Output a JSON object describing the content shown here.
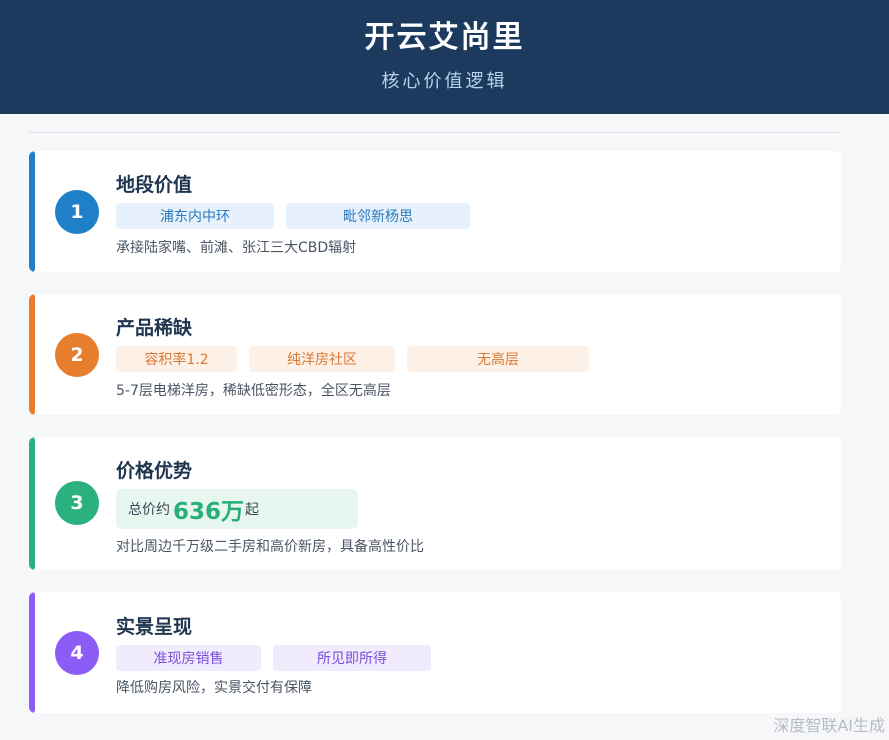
{
  "header": {
    "title": "开云艾尚里",
    "subtitle": "核心价值逻辑"
  },
  "cards": [
    {
      "number": "1",
      "title": "地段价值",
      "accent": "#1f80c8",
      "tags": [
        "浦东内中环",
        "毗邻新杨思"
      ],
      "description": "承接陆家嘴、前滩、张江三大CBD辐射"
    },
    {
      "number": "2",
      "title": "产品稀缺",
      "accent": "#e67e2e",
      "tags": [
        "容积率1.2",
        "纯洋房社区",
        "无高层"
      ],
      "description": "5-7层电梯洋房，稀缺低密形态，全区无高层"
    },
    {
      "number": "3",
      "title": "价格优势",
      "accent": "#2bb07f",
      "price": {
        "prefix": "总价约",
        "value": "636万",
        "suffix": "起"
      },
      "description": "对比周边千万级二手房和高价新房，具备高性价比"
    },
    {
      "number": "4",
      "title": "实景呈现",
      "accent": "#8b5cf6",
      "tags": [
        "准现房销售",
        "所见即所得"
      ],
      "description": "降低购房风险，实景交付有保障"
    }
  ],
  "watermark": "深度智联AI生成"
}
